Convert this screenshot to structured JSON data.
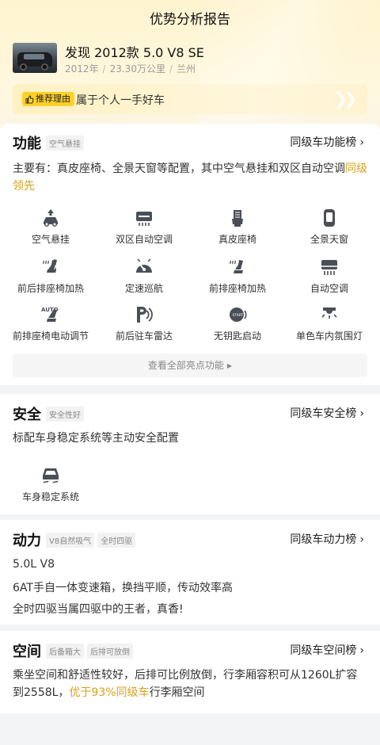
{
  "header": {
    "title": "优势分析报告"
  },
  "car": {
    "name": "发现 2012款 5.0 V8 SE",
    "year": "2012年",
    "mileage": "23.30万公里",
    "city": "兰州"
  },
  "reason": {
    "tag": "推荐理由",
    "text": "属于个人一手好车"
  },
  "function": {
    "title": "功能",
    "tags": [
      "空气悬挂"
    ],
    "rank_label": "同级车功能榜",
    "desc_main": "主要有：真皮座椅、全景天窗等配置，其中空气悬挂和双区自动空调",
    "desc_highlight": "同级领先",
    "features": [
      {
        "label": "空气悬挂",
        "icon": "air-suspension-icon"
      },
      {
        "label": "双区自动空调",
        "icon": "dual-zone-ac-icon"
      },
      {
        "label": "真皮座椅",
        "icon": "leather-seat-icon"
      },
      {
        "label": "全景天窗",
        "icon": "panoramic-sunroof-icon"
      },
      {
        "label": "前后排座椅加热",
        "icon": "seat-heating-icon"
      },
      {
        "label": "定速巡航",
        "icon": "cruise-control-icon"
      },
      {
        "label": "前排座椅加热",
        "icon": "front-seat-heating-icon"
      },
      {
        "label": "自动空调",
        "icon": "auto-ac-icon"
      },
      {
        "label": "前排座椅电动调节",
        "icon": "power-seat-icon"
      },
      {
        "label": "前后驻车雷达",
        "icon": "parking-radar-icon"
      },
      {
        "label": "无钥匙启动",
        "icon": "keyless-start-icon"
      },
      {
        "label": "单色车内氛围灯",
        "icon": "ambient-light-icon"
      }
    ],
    "more_label": "查看全部亮点功能"
  },
  "safety": {
    "title": "安全",
    "tags": [
      "安全性好"
    ],
    "rank_label": "同级车安全榜",
    "desc": "标配车身稳定系统等主动安全配置",
    "features": [
      {
        "label": "车身稳定系统",
        "icon": "stability-control-icon"
      }
    ]
  },
  "power": {
    "title": "动力",
    "tags": [
      "V8自然吸气",
      "全时四驱"
    ],
    "rank_label": "同级车动力榜",
    "lines": [
      "5.0L V8",
      "6AT手自一体变速箱，换挡平顺，传动效率高",
      "全时四驱当属四驱中的王者，真香!"
    ]
  },
  "space": {
    "title": "空间",
    "tags": [
      "后备箱大",
      "后排可放倒"
    ],
    "rank_label": "同级车空间榜",
    "desc_main": "乘坐空间和舒适性较好，后排可比例放倒，行李厢容积可从1260L扩容到2558L，",
    "desc_highlight": "优于93%同级车",
    "desc_tail": "行李厢空间"
  },
  "colors": {
    "accent": "#d9a11b",
    "tag_yellow": "#ffd129"
  }
}
